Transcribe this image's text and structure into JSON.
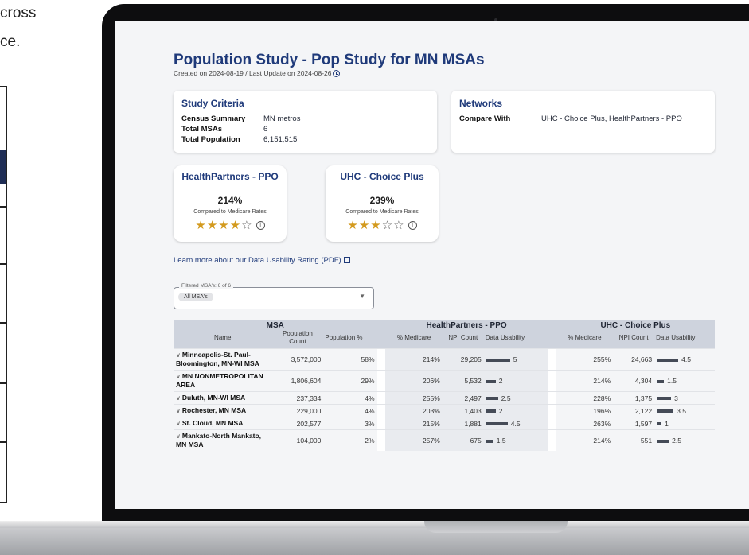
{
  "background_text": {
    "line1": "cross",
    "line2": "ce."
  },
  "page": {
    "title": "Population Study - Pop Study for MN MSAs",
    "subtitle": "Created on 2024-08-19 / Last Update on 2024-08-26"
  },
  "study_criteria": {
    "heading": "Study Criteria",
    "rows": [
      {
        "label": "Census Summary",
        "value": "MN metros"
      },
      {
        "label": "Total MSAs",
        "value": "6"
      },
      {
        "label": "Total Population",
        "value": "6,151,515"
      }
    ]
  },
  "networks": {
    "heading": "Networks",
    "compare_label": "Compare With",
    "compare_value": "UHC - Choice Plus, HealthPartners - PPO"
  },
  "rating_cards": [
    {
      "name": "HealthPartners - PPO",
      "percent": "214%",
      "caption": "Compared to Medicare Rates",
      "stars": 4,
      "max_stars": 5
    },
    {
      "name": "UHC - Choice Plus",
      "percent": "239%",
      "caption": "Compared to Medicare Rates",
      "stars": 3,
      "max_stars": 5
    }
  ],
  "learn_link": "Learn more about our Data Usability Rating (PDF)",
  "filter": {
    "label": "Filtered MSA's: 6 of 6",
    "chip": "All MSA's"
  },
  "table": {
    "groups": {
      "msa": "MSA",
      "hp": "HealthPartners - PPO",
      "uhc": "UHC - Choice Plus"
    },
    "columns": {
      "name": "Name",
      "pop_count": "Population Count",
      "pop_pct": "Population %",
      "medicare": "% Medicare",
      "npi": "NPI Count",
      "usability": "Data Usability"
    },
    "rows": [
      {
        "name": "Minneapolis-St. Paul-Bloomington, MN-WI MSA",
        "pop": "3,572,000",
        "pct": "58%",
        "hp_med": "214%",
        "hp_npi": "29,205",
        "hp_du": "5",
        "uhc_med": "255%",
        "uhc_npi": "24,663",
        "uhc_du": "4.5"
      },
      {
        "name": "MN NONMETROPOLITAN AREA",
        "pop": "1,806,604",
        "pct": "29%",
        "hp_med": "206%",
        "hp_npi": "5,532",
        "hp_du": "2",
        "uhc_med": "214%",
        "uhc_npi": "4,304",
        "uhc_du": "1.5"
      },
      {
        "name": "Duluth, MN-WI MSA",
        "pop": "237,334",
        "pct": "4%",
        "hp_med": "255%",
        "hp_npi": "2,497",
        "hp_du": "2.5",
        "uhc_med": "228%",
        "uhc_npi": "1,375",
        "uhc_du": "3"
      },
      {
        "name": "Rochester, MN MSA",
        "pop": "229,000",
        "pct": "4%",
        "hp_med": "203%",
        "hp_npi": "1,403",
        "hp_du": "2",
        "uhc_med": "196%",
        "uhc_npi": "2,122",
        "uhc_du": "3.5"
      },
      {
        "name": "St. Cloud, MN MSA",
        "pop": "202,577",
        "pct": "3%",
        "hp_med": "215%",
        "hp_npi": "1,881",
        "hp_du": "4.5",
        "uhc_med": "263%",
        "uhc_npi": "1,597",
        "uhc_du": "1"
      },
      {
        "name": "Mankato-North Mankato, MN MSA",
        "pop": "104,000",
        "pct": "2%",
        "hp_med": "257%",
        "hp_npi": "675",
        "hp_du": "1.5",
        "uhc_med": "214%",
        "uhc_npi": "551",
        "uhc_du": "2.5"
      }
    ]
  },
  "colors": {
    "accent": "#1f3a7a",
    "star": "#d39a1e",
    "header_bg": "#ced3dd",
    "bar": "#454b57"
  }
}
